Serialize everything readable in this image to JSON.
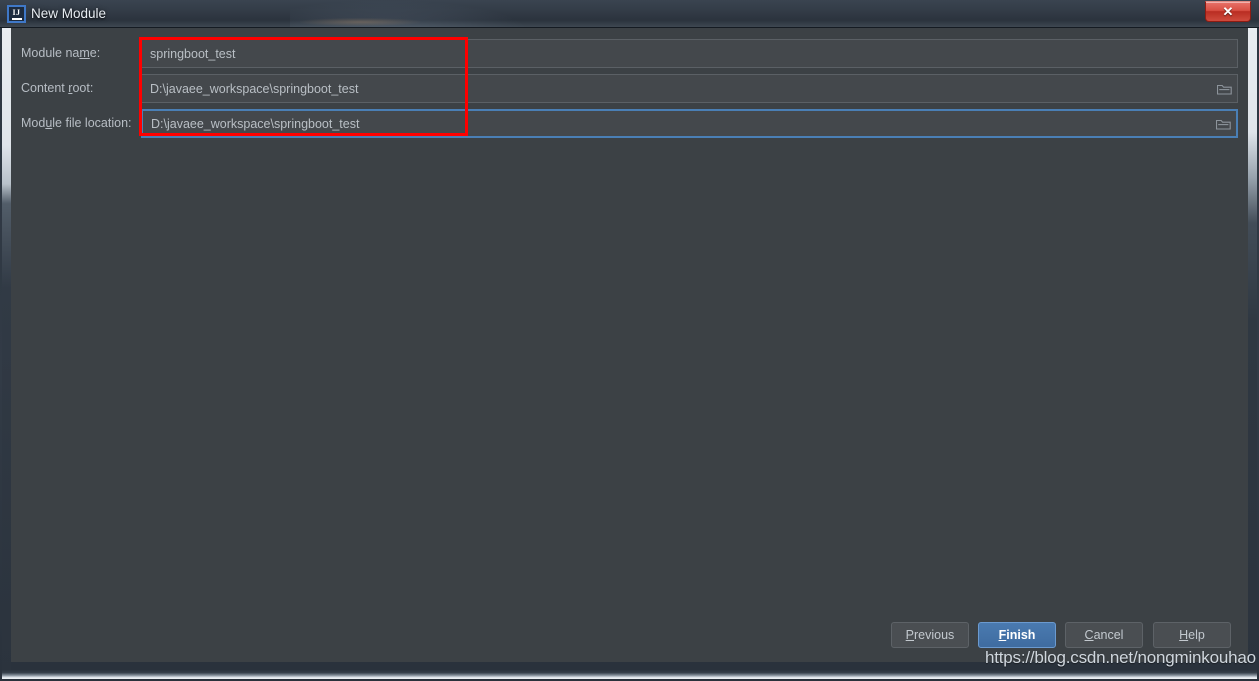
{
  "window": {
    "title": "New Module",
    "app_icon": "intellij-idea-icon",
    "icon_text": "IJ",
    "close_label": "✕"
  },
  "form": {
    "rows": [
      {
        "label_pre": "Module na",
        "label_mnemonic": "m",
        "label_post": "e:",
        "value": "springboot_test",
        "has_browse": false,
        "focused": false,
        "name": "module-name"
      },
      {
        "label_pre": "Content ",
        "label_mnemonic": "r",
        "label_post": "oot:",
        "value": "D:\\javaee_workspace\\springboot_test",
        "has_browse": true,
        "focused": false,
        "name": "content-root"
      },
      {
        "label_pre": "Mod",
        "label_mnemonic": "u",
        "label_post": "le file location:",
        "value": "D:\\javaee_workspace\\springboot_test",
        "has_browse": true,
        "focused": true,
        "name": "module-file-location"
      }
    ]
  },
  "annotation": {
    "color": "#ff0000",
    "shape": "rectangle"
  },
  "buttons": {
    "previous": {
      "pre": "",
      "mnemonic": "P",
      "post": "revious"
    },
    "finish": {
      "pre": "",
      "mnemonic": "F",
      "post": "inish"
    },
    "cancel": {
      "pre": "",
      "mnemonic": "C",
      "post": "ancel"
    },
    "help": {
      "pre": "",
      "mnemonic": "H",
      "post": "elp"
    }
  },
  "watermark": {
    "text": "https://blog.csdn.net/nongminkouhao"
  },
  "colors": {
    "panel_bg": "#3c4145",
    "field_bg": "#44484c",
    "focus_border": "#4a7fb5",
    "primary_button": "#3f6ca0",
    "annotation": "#ff0000",
    "title_text": "#e8edf2"
  }
}
